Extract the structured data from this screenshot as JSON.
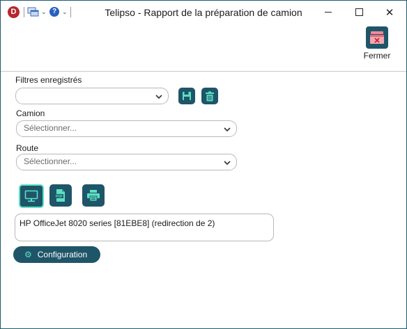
{
  "window": {
    "title": "Telipso - Rapport de la préparation de camion",
    "logo_letter": "D",
    "help_glyph": "?",
    "close_glyph": "✕"
  },
  "toolbar": {
    "close_label": "Fermer"
  },
  "filters": {
    "label": "Filtres enregistrés",
    "value": ""
  },
  "camion": {
    "label": "Camion",
    "placeholder": "Sélectionner..."
  },
  "route": {
    "label": "Route",
    "placeholder": "Sélectionner..."
  },
  "printer": {
    "value": "HP OfficeJet 8020 series [81EBE8] (redirection de 2)"
  },
  "config": {
    "label": "Configuration"
  },
  "colors": {
    "accent": "#1f5568",
    "highlight": "#5ce0c4",
    "logo": "#b7282e"
  },
  "icons": {
    "save": "save-icon",
    "delete": "trash-icon",
    "screen": "monitor-icon",
    "pdf": "pdf-icon",
    "print": "printer-icon",
    "close": "close-report-icon",
    "gear": "gear-icon"
  }
}
